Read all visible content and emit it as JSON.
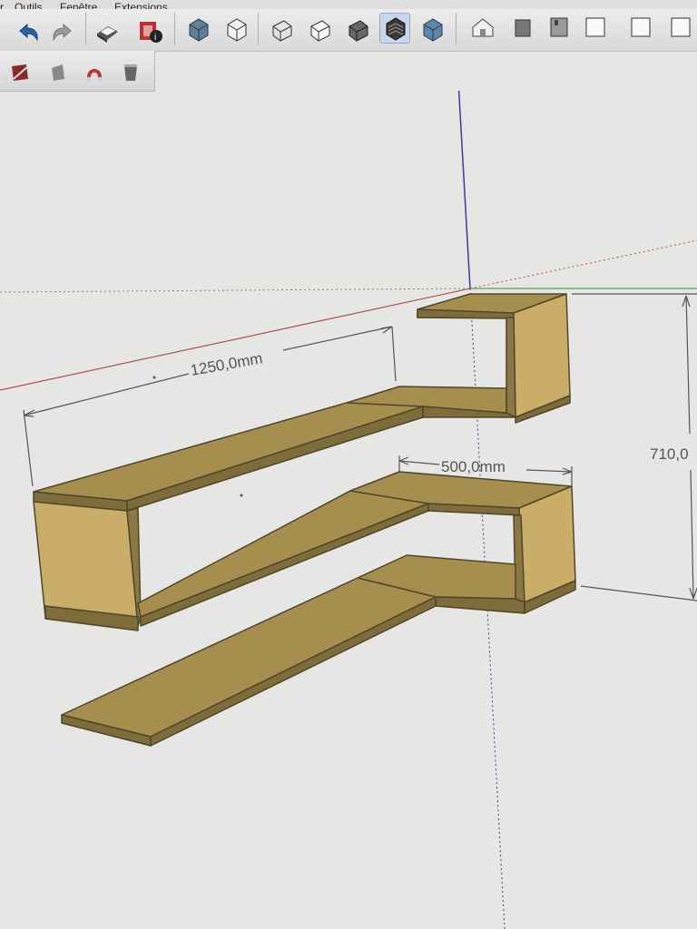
{
  "menu": {
    "items": [
      "r",
      "Outils",
      "Fenêtre",
      "Extensions"
    ]
  },
  "toolbar": {
    "buttons": [
      {
        "icon": "undo-icon"
      },
      {
        "icon": "redo-icon"
      },
      {
        "icon": "print-icon"
      },
      {
        "icon": "model-info-icon"
      },
      {
        "icon": "iso-view-icon"
      },
      {
        "icon": "top-view-icon"
      },
      {
        "icon": "front-view-icon"
      },
      {
        "icon": "right-view-icon"
      },
      {
        "icon": "back-view-icon"
      },
      {
        "icon": "left-view-icon"
      },
      {
        "icon": "bottom-view-icon"
      },
      {
        "icon": "xray-style-icon"
      },
      {
        "icon": "wireframe-style-icon"
      },
      {
        "icon": "hidden-line-style-icon"
      },
      {
        "icon": "shaded-style-icon"
      },
      {
        "icon": "shaded-textures-style-icon",
        "active": true
      },
      {
        "icon": "monochrome-style-icon"
      },
      {
        "icon": "house-icon"
      },
      {
        "icon": "box-icon"
      },
      {
        "icon": "camera-icon"
      }
    ],
    "secondary": [
      {
        "icon": "paint-bucket-icon"
      },
      {
        "icon": "eraser-icon"
      },
      {
        "icon": "magnet-icon"
      },
      {
        "icon": "bucket-icon"
      }
    ]
  },
  "dimensions": {
    "length": "1250,0mm",
    "depth": "500,0mm",
    "height": "710,0"
  },
  "colors": {
    "wood": "#a58e4e",
    "wood_light": "#b9a05a",
    "wood_side": "#c9ad69",
    "edge": "#4f472c",
    "axis_red": "#b45050",
    "axis_green": "#5aa05a",
    "axis_blue": "#3c3ca0"
  }
}
